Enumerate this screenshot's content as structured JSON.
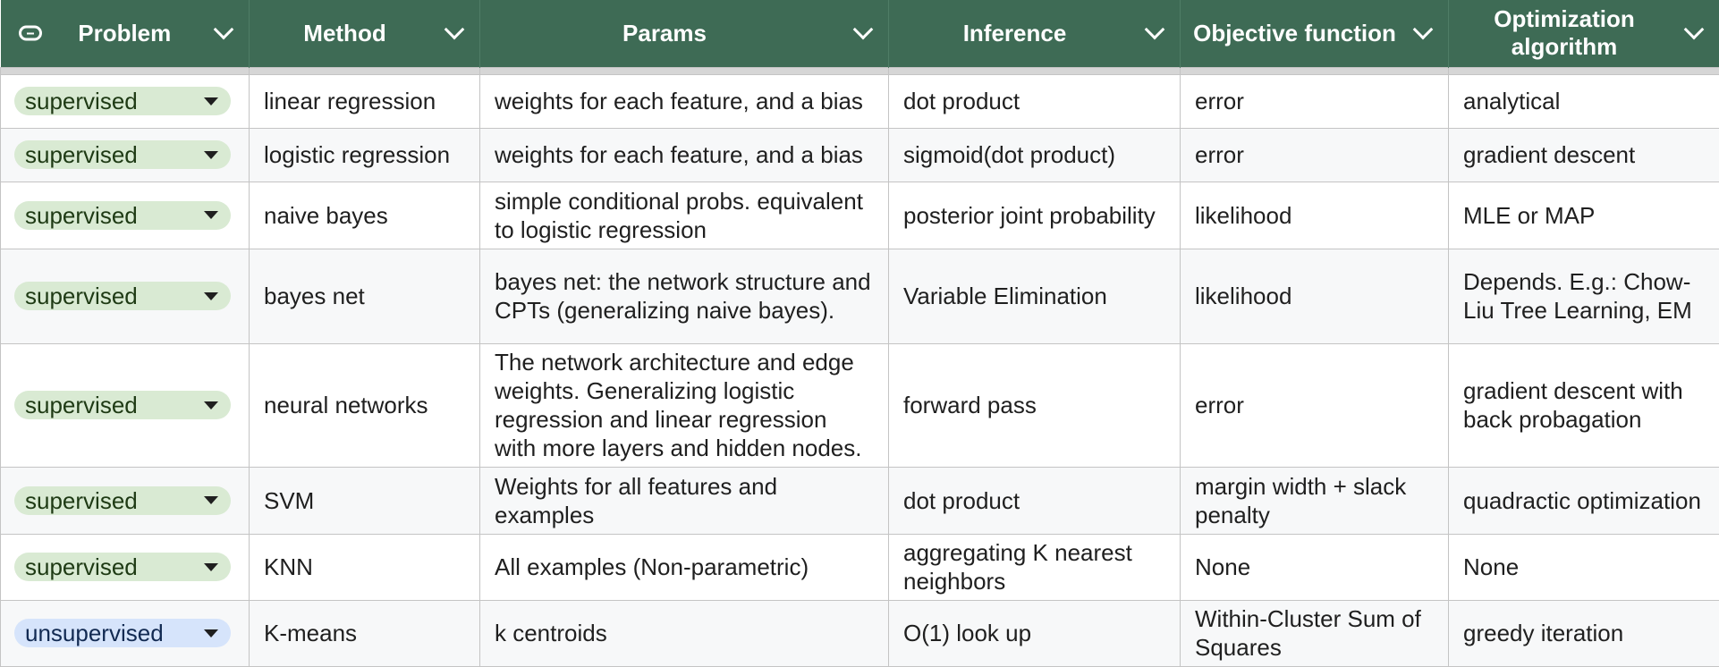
{
  "headers": [
    {
      "label": "Problem"
    },
    {
      "label": "Method"
    },
    {
      "label": "Params"
    },
    {
      "label": "Inference"
    },
    {
      "label": "Objective function"
    },
    {
      "label": "Optimization algorithm"
    }
  ],
  "colors": {
    "header_bg": "#3e6b55",
    "chip_supervised": "#d9ead3",
    "chip_unsupervised": "#d6e4fb"
  },
  "rows": [
    {
      "problem": "supervised",
      "method": "linear regression",
      "params": "weights for each feature, and a bias",
      "inference": "dot product",
      "objective": "error",
      "optimization": "analytical"
    },
    {
      "problem": "supervised",
      "method": "logistic regression",
      "params": "weights for each feature, and a bias",
      "inference": "sigmoid(dot product)",
      "objective": "error",
      "optimization": "gradient descent"
    },
    {
      "problem": "supervised",
      "method": "naive bayes",
      "params": "simple conditional probs. equivalent to logistic regression",
      "inference": "posterior joint probability",
      "objective": "likelihood",
      "optimization": "MLE or MAP"
    },
    {
      "problem": "supervised",
      "method": "bayes net",
      "params": "bayes net: the network structure and CPTs (generalizing naive bayes).",
      "inference": "Variable Elimination",
      "objective": "likelihood",
      "optimization": "Depends. E.g.: Chow-Liu Tree Learning, EM"
    },
    {
      "problem": "supervised",
      "method": "neural networks",
      "params": "The network architecture and edge weights. Generalizing logistic regression and linear regression with more layers and hidden nodes.",
      "inference": "forward pass",
      "objective": "error",
      "optimization": "gradient descent with back probagation"
    },
    {
      "problem": "supervised",
      "method": "SVM",
      "params": "Weights for all features and examples",
      "inference": "dot product",
      "objective": "margin width + slack penalty",
      "optimization": "quadractic optimization"
    },
    {
      "problem": "supervised",
      "method": "KNN",
      "params": "All examples (Non-parametric)",
      "inference": "aggregating K nearest neighbors",
      "objective": "None",
      "optimization": "None"
    },
    {
      "problem": "unsupervised",
      "method": "K-means",
      "params": "k centroids",
      "inference": "O(1) look up",
      "objective": "Within-Cluster Sum of Squares",
      "optimization": "greedy iteration"
    }
  ]
}
